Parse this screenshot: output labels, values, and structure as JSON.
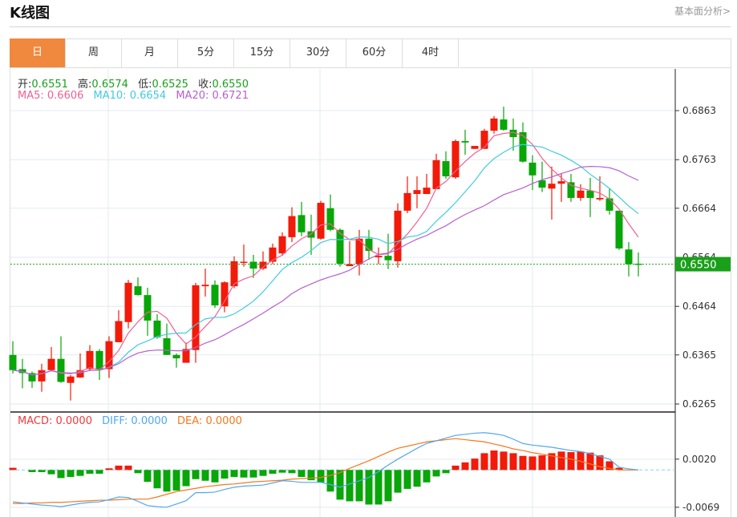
{
  "header": {
    "title": "K线图",
    "fundamental_link": "基本面分析>"
  },
  "tabs": [
    {
      "label": "日",
      "active": true
    },
    {
      "label": "周"
    },
    {
      "label": "月"
    },
    {
      "label": "5分"
    },
    {
      "label": "15分"
    },
    {
      "label": "30分"
    },
    {
      "label": "60分"
    },
    {
      "label": "4时"
    }
  ],
  "ohlc_legend": {
    "open_label": "开:",
    "open": "0.6551",
    "high_label": "高:",
    "high": "0.6574",
    "low_label": "低:",
    "low": "0.6525",
    "close_label": "收:",
    "close": "0.6550"
  },
  "ma_legend": {
    "ma5": "MA5: 0.6606",
    "ma10": "MA10: 0.6654",
    "ma20": "MA20: 0.6721"
  },
  "macd_legend": {
    "macd": "MACD: 0.0000",
    "diff": "DIFF: 0.0000",
    "dea": "DEA: 0.0000"
  },
  "colors": {
    "up": "#f21a08",
    "down": "#08a608",
    "ma5": "#f0608f",
    "ma10": "#40cbe0",
    "ma20": "#b660d0",
    "diff": "#52a8f2",
    "dea": "#f5781e",
    "active_tab": "#f0883e",
    "last_price": "#1aa01a"
  },
  "chart_data": [
    {
      "type": "candlestick",
      "price_ticks": [
        "0.6863",
        "0.6763",
        "0.6664",
        "0.6564",
        "0.6464",
        "0.6365",
        "0.6265"
      ],
      "ylim": [
        0.6265,
        0.6863
      ],
      "last_price": "0.6550",
      "ma_periods": [
        5,
        10,
        20
      ],
      "ohlc": [
        [
          0.6365,
          0.6393,
          0.6327,
          0.6334
        ],
        [
          0.6336,
          0.6357,
          0.6297,
          0.6328
        ],
        [
          0.6328,
          0.6331,
          0.6298,
          0.6311
        ],
        [
          0.6311,
          0.6347,
          0.629,
          0.6334
        ],
        [
          0.6334,
          0.6381,
          0.6332,
          0.6357
        ],
        [
          0.6357,
          0.6403,
          0.6308,
          0.631
        ],
        [
          0.6308,
          0.6324,
          0.6272,
          0.6321
        ],
        [
          0.6319,
          0.6368,
          0.6318,
          0.6334
        ],
        [
          0.6336,
          0.6385,
          0.6332,
          0.6373
        ],
        [
          0.6373,
          0.6377,
          0.6314,
          0.6336
        ],
        [
          0.6336,
          0.6403,
          0.6318,
          0.6393
        ],
        [
          0.6391,
          0.6456,
          0.6391,
          0.6434
        ],
        [
          0.6432,
          0.6518,
          0.6419,
          0.6512
        ],
        [
          0.6505,
          0.6523,
          0.6486,
          0.6487
        ],
        [
          0.6487,
          0.6502,
          0.6404,
          0.6435
        ],
        [
          0.6435,
          0.6448,
          0.6398,
          0.6401
        ],
        [
          0.6399,
          0.6429,
          0.6365,
          0.6365
        ],
        [
          0.6365,
          0.6368,
          0.6339,
          0.6358
        ],
        [
          0.6349,
          0.639,
          0.6349,
          0.6377
        ],
        [
          0.6375,
          0.6512,
          0.6349,
          0.6507
        ],
        [
          0.6505,
          0.6541,
          0.6484,
          0.6508
        ],
        [
          0.6508,
          0.6517,
          0.6461,
          0.6466
        ],
        [
          0.6464,
          0.6515,
          0.6452,
          0.6513
        ],
        [
          0.6505,
          0.6566,
          0.6501,
          0.6556
        ],
        [
          0.6553,
          0.659,
          0.6545,
          0.6555
        ],
        [
          0.6555,
          0.6569,
          0.6522,
          0.6541
        ],
        [
          0.6541,
          0.6576,
          0.6538,
          0.6555
        ],
        [
          0.6555,
          0.6592,
          0.655,
          0.6584
        ],
        [
          0.6572,
          0.6615,
          0.6567,
          0.6607
        ],
        [
          0.6605,
          0.6666,
          0.6595,
          0.6648
        ],
        [
          0.665,
          0.6677,
          0.6607,
          0.6615
        ],
        [
          0.6617,
          0.6651,
          0.6569,
          0.6604
        ],
        [
          0.6602,
          0.6679,
          0.66,
          0.6675
        ],
        [
          0.6664,
          0.6692,
          0.6617,
          0.662
        ],
        [
          0.662,
          0.6623,
          0.6545,
          0.6551
        ],
        [
          0.6546,
          0.6597,
          0.6546,
          0.655
        ],
        [
          0.655,
          0.662,
          0.6527,
          0.6602
        ],
        [
          0.6602,
          0.662,
          0.6559,
          0.6577
        ],
        [
          0.6564,
          0.6584,
          0.655,
          0.6567
        ],
        [
          0.6567,
          0.6612,
          0.654,
          0.6558
        ],
        [
          0.6556,
          0.6674,
          0.6543,
          0.6659
        ],
        [
          0.6659,
          0.6729,
          0.6654,
          0.6695
        ],
        [
          0.6693,
          0.6729,
          0.6664,
          0.6701
        ],
        [
          0.6693,
          0.6734,
          0.6693,
          0.6706
        ],
        [
          0.6703,
          0.6775,
          0.6703,
          0.6762
        ],
        [
          0.676,
          0.678,
          0.6724,
          0.6729
        ],
        [
          0.6727,
          0.6804,
          0.6724,
          0.6801
        ],
        [
          0.6801,
          0.6824,
          0.6773,
          0.6798
        ],
        [
          0.6785,
          0.6791,
          0.6785,
          0.6791
        ],
        [
          0.6785,
          0.6826,
          0.6785,
          0.6822
        ],
        [
          0.6822,
          0.6852,
          0.6816,
          0.6847
        ],
        [
          0.6845,
          0.6871,
          0.6822,
          0.6824
        ],
        [
          0.6824,
          0.6847,
          0.6781,
          0.6809
        ],
        [
          0.6819,
          0.6839,
          0.6757,
          0.6759
        ],
        [
          0.6757,
          0.6772,
          0.6701,
          0.6731
        ],
        [
          0.6721,
          0.6759,
          0.6697,
          0.6706
        ],
        [
          0.6704,
          0.6749,
          0.6641,
          0.6714
        ],
        [
          0.6714,
          0.6734,
          0.6677,
          0.6719
        ],
        [
          0.6717,
          0.6734,
          0.6677,
          0.6685
        ],
        [
          0.6685,
          0.6713,
          0.6679,
          0.67
        ],
        [
          0.67,
          0.6726,
          0.6646,
          0.6685
        ],
        [
          0.6682,
          0.6729,
          0.6679,
          0.6685
        ],
        [
          0.6684,
          0.6705,
          0.6651,
          0.6659
        ],
        [
          0.6659,
          0.6659,
          0.6579,
          0.6582
        ],
        [
          0.658,
          0.6595,
          0.6525,
          0.655
        ],
        [
          0.6551,
          0.6574,
          0.6525,
          0.655
        ]
      ]
    },
    {
      "type": "macd",
      "ticks": [
        "0.0020",
        "-0.0069"
      ],
      "macd": [
        0.0004,
        0,
        -0.0004,
        -0.0004,
        -0.0008,
        -0.0015,
        -0.0013,
        -0.0011,
        -0.0007,
        -0.0007,
        0.0003,
        0.0008,
        0.0008,
        -0.0006,
        -0.0022,
        -0.0034,
        -0.004,
        -0.0038,
        -0.003,
        -0.0017,
        -0.002,
        -0.0023,
        -0.0016,
        -0.0013,
        -0.0014,
        -0.0014,
        -0.0011,
        -0.0007,
        -0.0005,
        -0.0006,
        -0.0013,
        -0.0019,
        -0.0023,
        -0.004,
        -0.0055,
        -0.0058,
        -0.0058,
        -0.0064,
        -0.0064,
        -0.0058,
        -0.0042,
        -0.0035,
        -0.0031,
        -0.0023,
        -0.0012,
        -0.0006,
        0.0008,
        0.0014,
        0.0021,
        0.0031,
        0.0036,
        0.0034,
        0.0031,
        0.0026,
        0.0025,
        0.0027,
        0.0031,
        0.0034,
        0.0033,
        0.0034,
        0.0032,
        0.0027,
        0.0016,
        0.0004,
        0.0,
        0.0
      ],
      "diff": [
        -0.0059,
        -0.0061,
        -0.0063,
        -0.0065,
        -0.0066,
        -0.0068,
        -0.0065,
        -0.0062,
        -0.006,
        -0.0059,
        -0.0055,
        -0.005,
        -0.0051,
        -0.0058,
        -0.0066,
        -0.0068,
        -0.0069,
        -0.0063,
        -0.0057,
        -0.0042,
        -0.0042,
        -0.0041,
        -0.0036,
        -0.0032,
        -0.003,
        -0.0029,
        -0.0028,
        -0.0024,
        -0.002,
        -0.0021,
        -0.0023,
        -0.0023,
        -0.0023,
        -0.0027,
        -0.0032,
        -0.0026,
        -0.002,
        -0.0014,
        -0.0003,
        0.0009,
        0.002,
        0.003,
        0.004,
        0.0049,
        0.0054,
        0.0059,
        0.0064,
        0.0066,
        0.0068,
        0.0069,
        0.0067,
        0.0064,
        0.0057,
        0.0049,
        0.0046,
        0.0044,
        0.0042,
        0.0039,
        0.0036,
        0.0034,
        0.003,
        0.0025,
        0.002,
        0.0005,
        0.0002,
        0.0
      ],
      "dea": [
        -0.0062,
        -0.0062,
        -0.0061,
        -0.0061,
        -0.006,
        -0.006,
        -0.0059,
        -0.0058,
        -0.0057,
        -0.0056,
        -0.0056,
        -0.0055,
        -0.0054,
        -0.0054,
        -0.0054,
        -0.005,
        -0.0045,
        -0.004,
        -0.0037,
        -0.0034,
        -0.0031,
        -0.0029,
        -0.0027,
        -0.0026,
        -0.0024,
        -0.0022,
        -0.0021,
        -0.002,
        -0.0019,
        -0.0017,
        -0.0016,
        -0.0015,
        -0.0014,
        -0.001,
        -0.0005,
        0.0003,
        0.001,
        0.0017,
        0.0025,
        0.0033,
        0.004,
        0.0044,
        0.0048,
        0.0052,
        0.0054,
        0.0056,
        0.0058,
        0.0056,
        0.0054,
        0.0052,
        0.0048,
        0.0044,
        0.0039,
        0.0036,
        0.0032,
        0.0029,
        0.0026,
        0.0023,
        0.002,
        0.0016,
        0.0011,
        0.0006,
        0.0003,
        0.0,
        0.0,
        0.0
      ]
    }
  ]
}
